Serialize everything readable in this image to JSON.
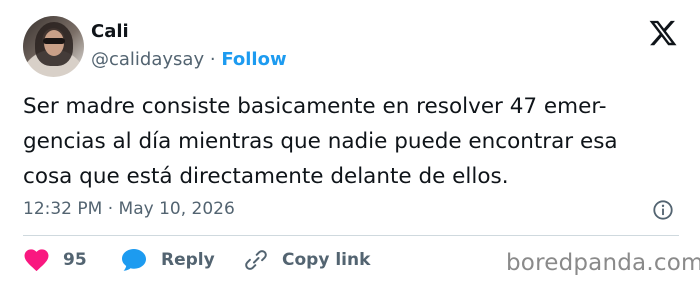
{
  "author": {
    "name": "Cali",
    "handle": "@calidaysay",
    "separator": "·",
    "follow_label": "Follow"
  },
  "tweet": {
    "lines": [
      "Ser madre consiste basicamente en resolver 47 emer-",
      "gencias al día mientras que nadie puede encontrar esa",
      "cosa que está directamente delante de ellos."
    ],
    "timestamp": "12:32 PM · May 10, 2026"
  },
  "actions": {
    "like_count": "95",
    "reply_label": "Reply",
    "copy_link_label": "Copy link"
  },
  "icons": {
    "platform": "x-logo-icon",
    "info": "info-icon",
    "like": "heart-icon",
    "reply": "speech-bubble-icon",
    "copy_link": "link-icon"
  },
  "colors": {
    "text": "#0f1419",
    "secondary": "#536471",
    "accent": "#1d9bf0",
    "like": "#f91880",
    "divider": "#cfd9de"
  },
  "watermark": "boredpanda.com"
}
